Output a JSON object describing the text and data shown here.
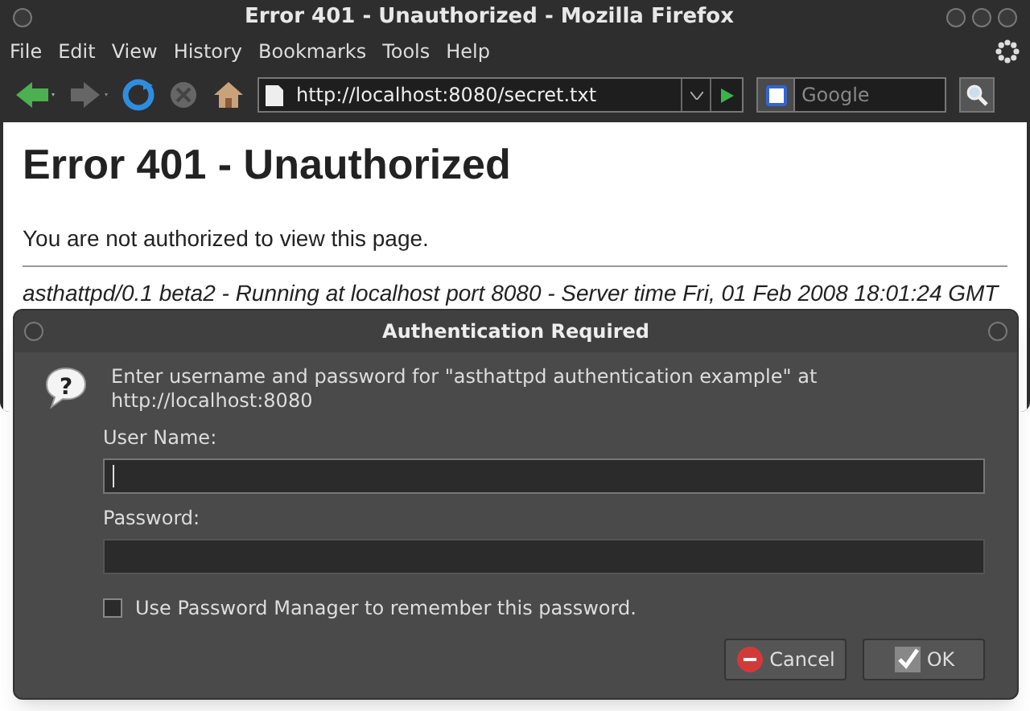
{
  "window": {
    "title": "Error 401 - Unauthorized - Mozilla Firefox"
  },
  "menu": [
    "File",
    "Edit",
    "View",
    "History",
    "Bookmarks",
    "Tools",
    "Help"
  ],
  "toolbar": {
    "url": "http://localhost:8080/secret.txt",
    "search_placeholder": "Google"
  },
  "page": {
    "heading": "Error 401 - Unauthorized",
    "message": "You are not authorized to view this page.",
    "footer": "asthattpd/0.1 beta2 - Running at localhost port 8080 - Server time Fri, 01 Feb 2008 18:01:24 GMT"
  },
  "dialog": {
    "title": "Authentication Required",
    "icon_glyph": "?",
    "message": "Enter username and password for \"asthattpd authentication example\" at http://localhost:8080",
    "fields": [
      {
        "label": "User Name:",
        "focused": true
      },
      {
        "label": "Password:",
        "focused": false
      }
    ],
    "remember": {
      "label": "Use Password Manager to remember this password.",
      "checked": false
    },
    "buttons": [
      {
        "kind": "cancel",
        "label": "Cancel"
      },
      {
        "kind": "ok",
        "label": "OK"
      }
    ]
  }
}
